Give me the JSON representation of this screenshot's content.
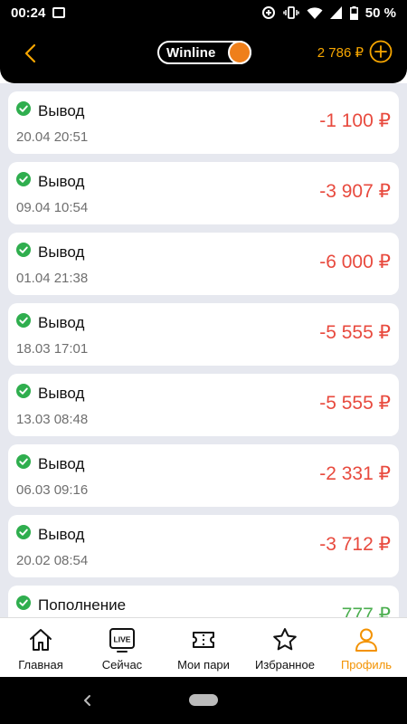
{
  "status_bar": {
    "time": "00:24",
    "battery": "50 %"
  },
  "header": {
    "logo_text": "Winline",
    "balance": "2 786 ₽"
  },
  "transactions": [
    {
      "title": "Вывод",
      "date": "20.04 20:51",
      "amount": "-1 100 ₽",
      "status_color": "#e84a3e"
    },
    {
      "title": "Вывод",
      "date": "09.04 10:54",
      "amount": "-3 907 ₽",
      "status_color": "#e84a3e"
    },
    {
      "title": "Вывод",
      "date": "01.04 21:38",
      "amount": "-6 000 ₽",
      "status_color": "#e84a3e"
    },
    {
      "title": "Вывод",
      "date": "18.03 17:01",
      "amount": "-5 555 ₽",
      "status_color": "#e84a3e"
    },
    {
      "title": "Вывод",
      "date": "13.03 08:48",
      "amount": "-5 555 ₽",
      "status_color": "#e84a3e"
    },
    {
      "title": "Вывод",
      "date": "06.03 09:16",
      "amount": "-2 331 ₽",
      "status_color": "#e84a3e"
    },
    {
      "title": "Вывод",
      "date": "20.02 08:54",
      "amount": "-3 712 ₽",
      "status_color": "#e84a3e"
    },
    {
      "title": "Пополнение",
      "date": "",
      "amount": "777 ₽",
      "status_color": "#4bae4f"
    }
  ],
  "tabs": [
    {
      "label": "Главная",
      "icon": "home-icon"
    },
    {
      "label": "Сейчас",
      "icon": "live-icon"
    },
    {
      "label": "Мои пари",
      "icon": "ticket-icon"
    },
    {
      "label": "Избранное",
      "icon": "star-icon"
    },
    {
      "label": "Профиль",
      "icon": "profile-icon",
      "active": true
    }
  ],
  "colors": {
    "accent": "#f39200",
    "negative": "#e84a3e",
    "positive": "#4bae4f",
    "success_check": "#2fae4e"
  }
}
